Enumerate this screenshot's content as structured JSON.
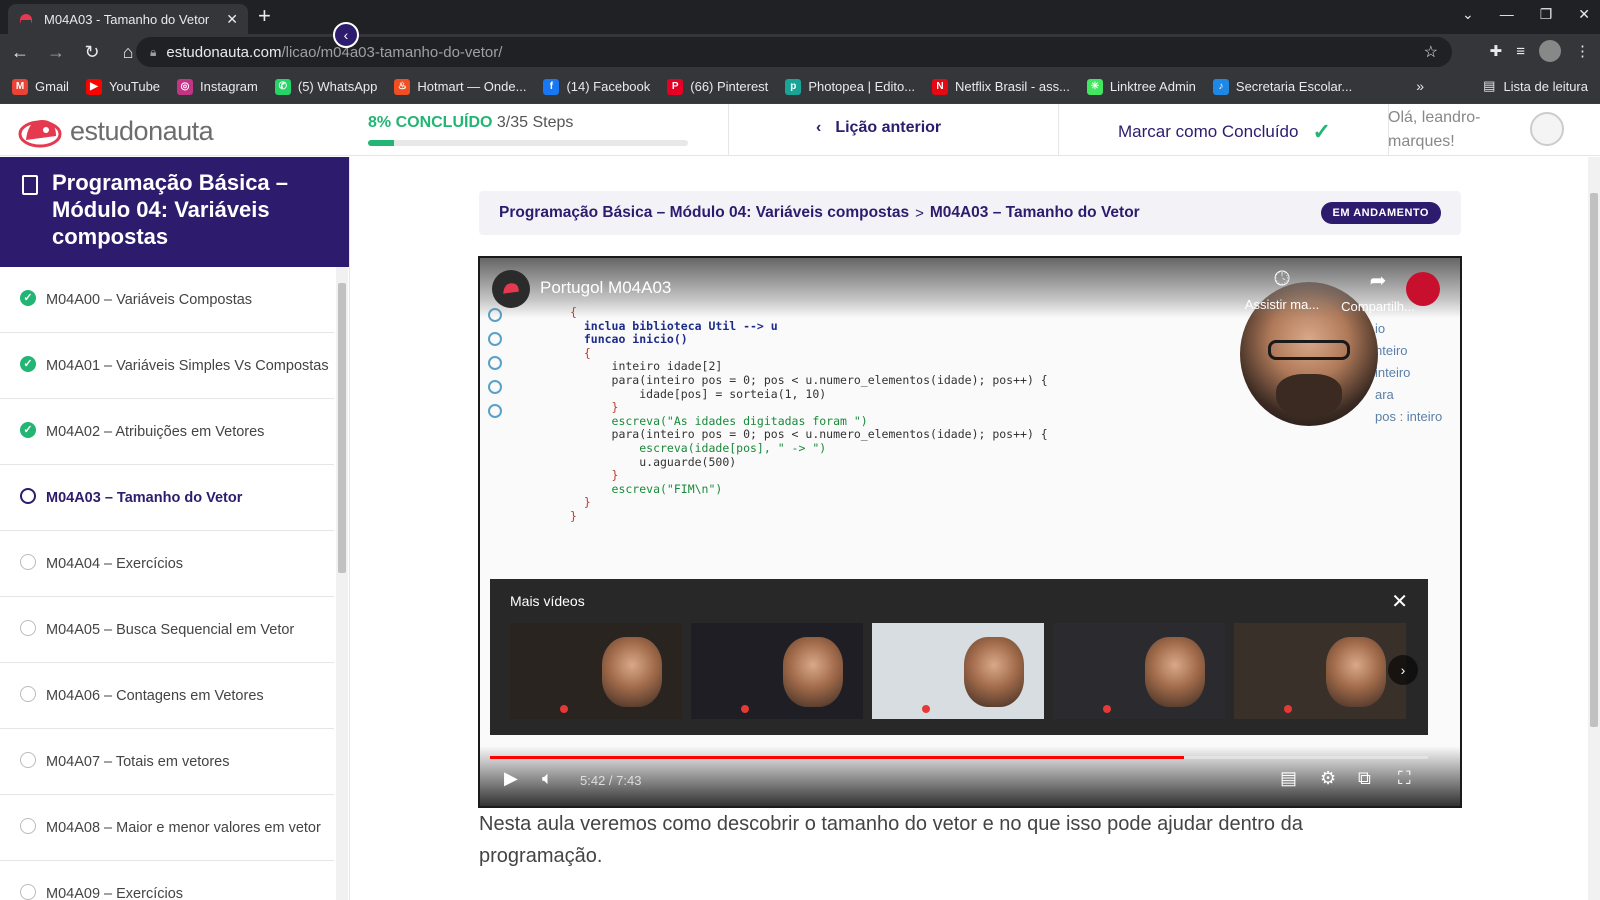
{
  "browser": {
    "tab_title": "M04A03 - Tamanho do Vetor",
    "tab_close": "✕",
    "new_tab": "+",
    "url_host": "estudonauta.com",
    "url_path": "/licao/m04a03-tamanho-do-vetor/",
    "bookmarks": [
      {
        "label": "Gmail",
        "color": "#ea4335",
        "glyph": "M"
      },
      {
        "label": "YouTube",
        "color": "#ff0000",
        "glyph": "▶"
      },
      {
        "label": "Instagram",
        "color": "#c13584",
        "glyph": "◎"
      },
      {
        "label": "(5) WhatsApp",
        "color": "#25d366",
        "glyph": "✆"
      },
      {
        "label": "Hotmart — Onde...",
        "color": "#f04e23",
        "glyph": "♨"
      },
      {
        "label": "(14) Facebook",
        "color": "#1877f2",
        "glyph": "f"
      },
      {
        "label": "(66) Pinterest",
        "color": "#e60023",
        "glyph": "P"
      },
      {
        "label": "Photopea | Edito...",
        "color": "#18a497",
        "glyph": "p"
      },
      {
        "label": "Netflix Brasil - ass...",
        "color": "#e50914",
        "glyph": "N"
      },
      {
        "label": "Linktree Admin",
        "color": "#43e660",
        "glyph": "✳"
      },
      {
        "label": "Secretaria Escolar...",
        "color": "#1e88e5",
        "glyph": "♪"
      }
    ],
    "bookmarks_more": "»",
    "reading_list": "Lista de leitura"
  },
  "header": {
    "brand": "estudonauta",
    "progress_pct_label": "8% CONCLUÍDO",
    "progress_steps": "3/35 Steps",
    "progress_fraction": 0.08,
    "prev_lesson": "Lição anterior",
    "mark_done": "Marcar como Concluído",
    "greeting": "Olá, leandro-marques!"
  },
  "sidebar": {
    "title": "Programação Básica – Módulo 04: Variáveis compostas",
    "lessons": [
      {
        "label": "M04A00 – Variáveis Compostas",
        "status": "done"
      },
      {
        "label": "M04A01 – Variáveis Simples Vs Compostas",
        "status": "done"
      },
      {
        "label": "M04A02 – Atribuições em Vetores",
        "status": "done"
      },
      {
        "label": "M04A03 – Tamanho do Vetor",
        "status": "current"
      },
      {
        "label": "M04A04 – Exercícios",
        "status": "todo"
      },
      {
        "label": "M04A05 – Busca Sequencial em Vetor",
        "status": "todo"
      },
      {
        "label": "M04A06 – Contagens em Vetores",
        "status": "todo"
      },
      {
        "label": "M04A07 – Totais em vetores",
        "status": "todo"
      },
      {
        "label": "M04A08 – Maior e menor valores em vetor",
        "status": "todo"
      },
      {
        "label": "M04A09 – Exercícios",
        "status": "todo"
      }
    ]
  },
  "main": {
    "breadcrumb_course": "Programação Básica – Módulo 04: Variáveis compostas",
    "breadcrumb_sep": ">",
    "breadcrumb_lesson": "M04A03 – Tamanho do Vetor",
    "status_badge": "EM ANDAMENTO",
    "description": "Nesta aula veremos como descobrir o tamanho do vetor e no que isso pode ajudar dentro da programação."
  },
  "video": {
    "title": "Portugol M04A03",
    "watch_later": "Assistir ma...",
    "share": "Compartilh...",
    "more_videos": "Mais vídeos",
    "time": "5:42 / 7:43",
    "played_fraction": 0.74,
    "tree_items": [
      "io",
      "nteiro",
      "inteiro",
      "ara",
      "pos : inteiro"
    ],
    "code_lines": [
      {
        "t": "{",
        "c": "br"
      },
      {
        "t": "  inclua biblioteca Util --> u",
        "c": "kw"
      },
      {
        "t": "  funcao inicio()",
        "c": "kw"
      },
      {
        "t": "  {",
        "c": "br"
      },
      {
        "t": "      inteiro idade[2]",
        "c": ""
      },
      {
        "t": "      para(inteiro pos = 0; pos < u.numero_elementos(idade); pos++) {",
        "c": ""
      },
      {
        "t": "          idade[pos] = sorteia(1, 10)",
        "c": ""
      },
      {
        "t": "      }",
        "c": "br"
      },
      {
        "t": "      escreva(\"As idades digitadas foram \")",
        "c": "str"
      },
      {
        "t": "      para(inteiro pos = 0; pos < u.numero_elementos(idade); pos++) {",
        "c": ""
      },
      {
        "t": "          escreva(idade[pos], \" -> \")",
        "c": "str"
      },
      {
        "t": "          u.aguarde(500)",
        "c": ""
      },
      {
        "t": "      }",
        "c": "br"
      },
      {
        "t": "      escreva(\"FIM\\n\")",
        "c": "str"
      },
      {
        "t": "",
        "c": ""
      },
      {
        "t": "  }",
        "c": "br"
      },
      {
        "t": "}",
        "c": "br"
      }
    ],
    "thumbs": [
      {
        "bg": "#2a2420"
      },
      {
        "bg": "#1e1e24"
      },
      {
        "bg": "#d8dde2"
      },
      {
        "bg": "#2b2b2f"
      },
      {
        "bg": "#3a302a"
      }
    ]
  }
}
